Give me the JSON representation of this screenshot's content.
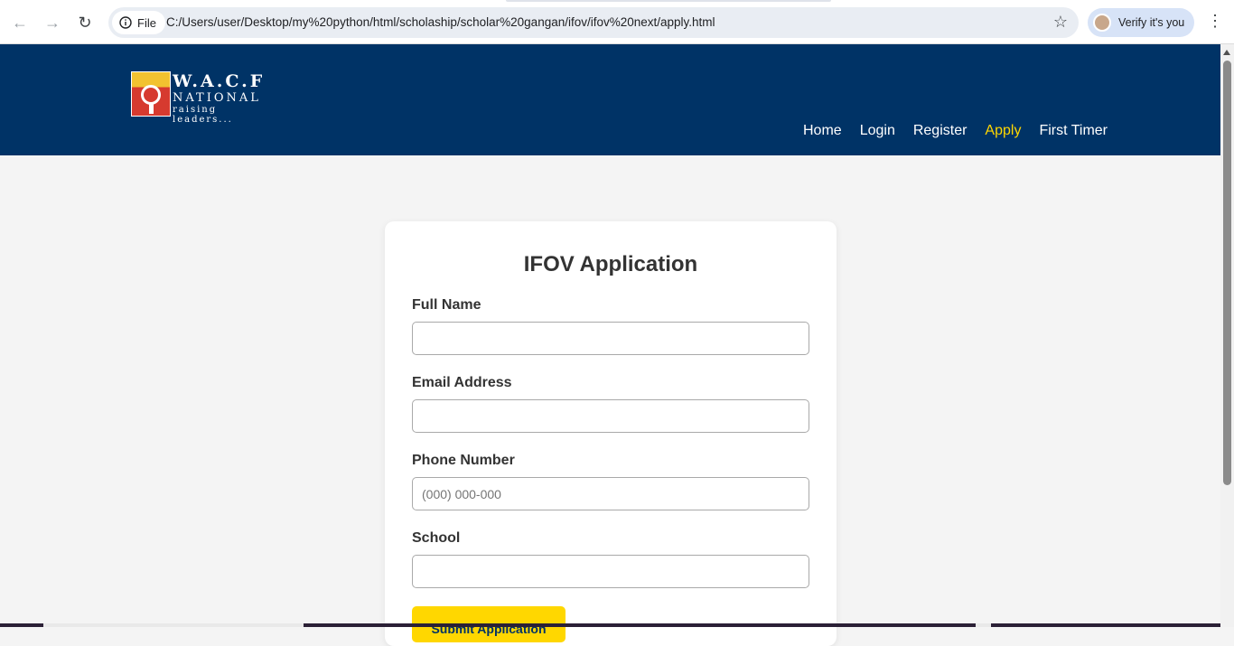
{
  "browser": {
    "back_icon": "arrow-left-icon",
    "forward_icon": "arrow-right-icon",
    "reload_icon": "reload-icon",
    "site_info_label": "File",
    "url": "C:/Users/user/Desktop/my%20python/html/scholaship/scholar%20gangan/ifov/ifov%20next/apply.html",
    "bookmark_icon": "star-icon",
    "profile_label": "Verify it's you",
    "menu_icon": "kebab-menu-icon"
  },
  "header": {
    "logo": {
      "line1": "W.A.C.F",
      "line2": "NATIONAL",
      "line3": "raising leaders..."
    },
    "nav": [
      {
        "label": "Home",
        "active": false
      },
      {
        "label": "Login",
        "active": false
      },
      {
        "label": "Register",
        "active": false
      },
      {
        "label": "Apply",
        "active": true
      },
      {
        "label": "First Timer",
        "active": false
      }
    ],
    "background_color": "#003366",
    "active_color": "#ffd700"
  },
  "form": {
    "title": "IFOV Application",
    "fields": [
      {
        "label": "Full Name",
        "value": "",
        "placeholder": ""
      },
      {
        "label": "Email Address",
        "value": "",
        "placeholder": ""
      },
      {
        "label": "Phone Number",
        "value": "",
        "placeholder": "(000) 000-000"
      },
      {
        "label": "School",
        "value": "",
        "placeholder": ""
      }
    ],
    "submit_label": "Submit Application",
    "submit_color": "#ffd700"
  }
}
